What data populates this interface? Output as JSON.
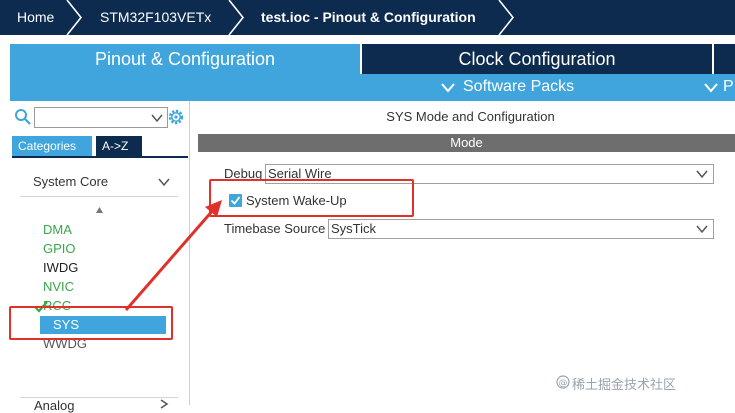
{
  "breadcrumb": {
    "home": "Home",
    "device": "STM32F103VETx",
    "file": "test.ioc - Pinout & Configuration"
  },
  "tabs": {
    "pinout": "Pinout & Configuration",
    "clock": "Clock Configuration"
  },
  "subbar": {
    "software_packs": "Software Packs",
    "p_truncated": "P"
  },
  "left_panel": {
    "category_tabs": [
      "Categories",
      "A->Z"
    ],
    "group": "System Core",
    "items": [
      "DMA",
      "GPIO",
      "IWDG",
      "NVIC",
      "RCC",
      "SYS",
      "WWDG"
    ],
    "next_group": "Analog"
  },
  "right_panel": {
    "title": "SYS Mode and Configuration",
    "mode_header": "Mode",
    "debug_label": "Debug",
    "debug_value": "Serial Wire",
    "wakeup_label": "System Wake-Up",
    "wakeup_checked": true,
    "timebase_label": "Timebase Source",
    "timebase_value": "SysTick"
  },
  "watermark": "稀土掘金技术社区",
  "colors": {
    "navy": "#0d2a4f",
    "blue": "#3fa5dc",
    "green": "#3aa64a",
    "annotation_red": "#e0302a",
    "mode_gray": "#6e6e6e"
  }
}
